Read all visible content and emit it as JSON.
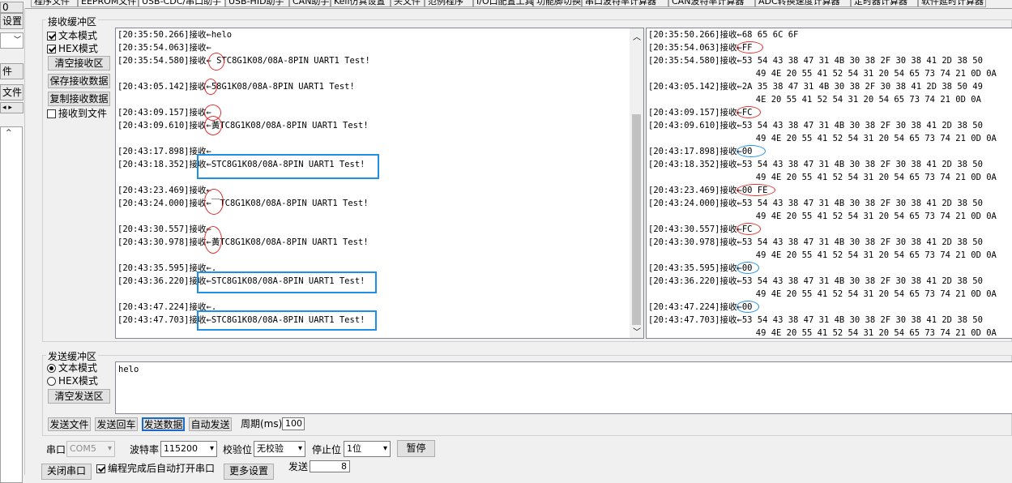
{
  "tabs": [
    "程序文件",
    "EEPROM文件",
    "USB-CDC/串口助手",
    "USB-HID助手",
    "CAN助手",
    "Keil仿真设置",
    "头文件",
    "范例程序",
    "I/O口配置工具",
    "功能脚切换",
    "串口波特率计算器",
    "CAN波特率计算器",
    "ADC转换速度计算器",
    "定时器计算器",
    "软件延时计算器"
  ],
  "left_strip": {
    "top_combo": "0",
    "btn1": "设置",
    "combo2": "",
    "btn3": "件",
    "btn4": "文件"
  },
  "receive": {
    "group_label": "接收缓冲区",
    "text_mode": "文本模式",
    "hex_mode": "HEX模式",
    "clear_btn": "清空接收区",
    "save_btn": "保存接收数据",
    "copy_btn": "复制接收数据",
    "to_file": "接收到文件",
    "text_lines": [
      "[20:35:50.266]接收←helo",
      "[20:35:54.063]接收←",
      "[20:35:54.580]接收← STC8G1K08/08A-8PIN UART1 Test!",
      "",
      "[20:43:05.142]接收←58G1K08/08A-8PIN UART1 Test!",
      "",
      "[20:43:09.157]接收←",
      "[20:43:09.610]接收←黃TC8G1K08/08A-8PIN UART1 Test!",
      "",
      "[20:43:17.898]接收←",
      "[20:43:18.352]接收←STC8G1K08/08A-8PIN UART1 Test!",
      "",
      "[20:43:23.469]接收←",
      "[20:43:24.000]接收←￣TC8G1K08/08A-8PIN UART1 Test!",
      "",
      "[20:43:30.557]接收←",
      "[20:43:30.978]接收←黃TC8G1K08/08A-8PIN UART1 Test!",
      "",
      "[20:43:35.595]接收←.",
      "[20:43:36.220]接收←STC8G1K08/08A-8PIN UART1 Test!",
      "",
      "[20:43:47.224]接收←.",
      "[20:43:47.703]接收←STC8G1K08/08A-8PIN UART1 Test!"
    ],
    "hex_lines": [
      "[20:35:50.266]接收←68 65 6C 6F",
      "[20:35:54.063]接收←FF",
      "[20:35:54.580]接收←53 54 43 38 47 31 4B 30 38 2F 30 38 41 2D 38 50",
      "                     49 4E 20 55 41 52 54 31 20 54 65 73 74 21 0D 0A",
      "[20:43:05.142]接收←2A 35 38 47 31 4B 30 38 2F 30 38 41 2D 38 50 49",
      "                     4E 20 55 41 52 54 31 20 54 65 73 74 21 0D 0A",
      "[20:43:09.157]接收←FC",
      "[20:43:09.610]接收←53 54 43 38 47 31 4B 30 38 2F 30 38 41 2D 38 50",
      "                     49 4E 20 55 41 52 54 31 20 54 65 73 74 21 0D 0A",
      "[20:43:17.898]接收←00",
      "[20:43:18.352]接收←53 54 43 38 47 31 4B 30 38 2F 30 38 41 2D 38 50",
      "                     49 4E 20 55 41 52 54 31 20 54 65 73 74 21 0D 0A",
      "[20:43:23.469]接收←00 FE",
      "[20:43:24.000]接收←53 54 43 38 47 31 4B 30 38 2F 30 38 41 2D 38 50",
      "                     49 4E 20 55 41 52 54 31 20 54 65 73 74 21 0D 0A",
      "[20:43:30.557]接收←FC",
      "[20:43:30.978]接收←53 54 43 38 47 31 4B 30 38 2F 30 38 41 2D 38 50",
      "                     49 4E 20 55 41 52 54 31 20 54 65 73 74 21 0D 0A",
      "[20:43:35.595]接收←00",
      "[20:43:36.220]接收←53 54 43 38 47 31 4B 30 38 2F 30 38 41 2D 38 50",
      "                     49 4E 20 55 41 52 54 31 20 54 65 73 74 21 0D 0A",
      "[20:43:47.224]接收←00",
      "[20:43:47.703]接收←53 54 43 38 47 31 4B 30 38 2F 30 38 41 2D 38 50",
      "                     49 4E 20 55 41 52 54 31 20 54 65 73 74 21 0D 0A"
    ]
  },
  "send": {
    "group_label": "发送缓冲区",
    "text_mode": "文本模式",
    "hex_mode": "HEX模式",
    "clear_btn": "清空发送区",
    "content": "helo",
    "send_file": "发送文件",
    "send_enter": "发送回车",
    "send_data": "发送数据",
    "auto_send": "自动发送",
    "period_label": "周期(ms)",
    "period_value": "100"
  },
  "port": {
    "port_label": "串口",
    "port_value": "COM5",
    "baud_label": "波特率",
    "baud_value": "115200",
    "parity_label": "校验位",
    "parity_value": "无校验",
    "stop_label": "停止位",
    "stop_value": "1位",
    "pause_btn": "暂停",
    "close_btn": "关闭串口",
    "auto_open": "编程完成后自动打开串口",
    "more_btn": "更多设置",
    "send_label": "发送",
    "send_count": "8"
  }
}
